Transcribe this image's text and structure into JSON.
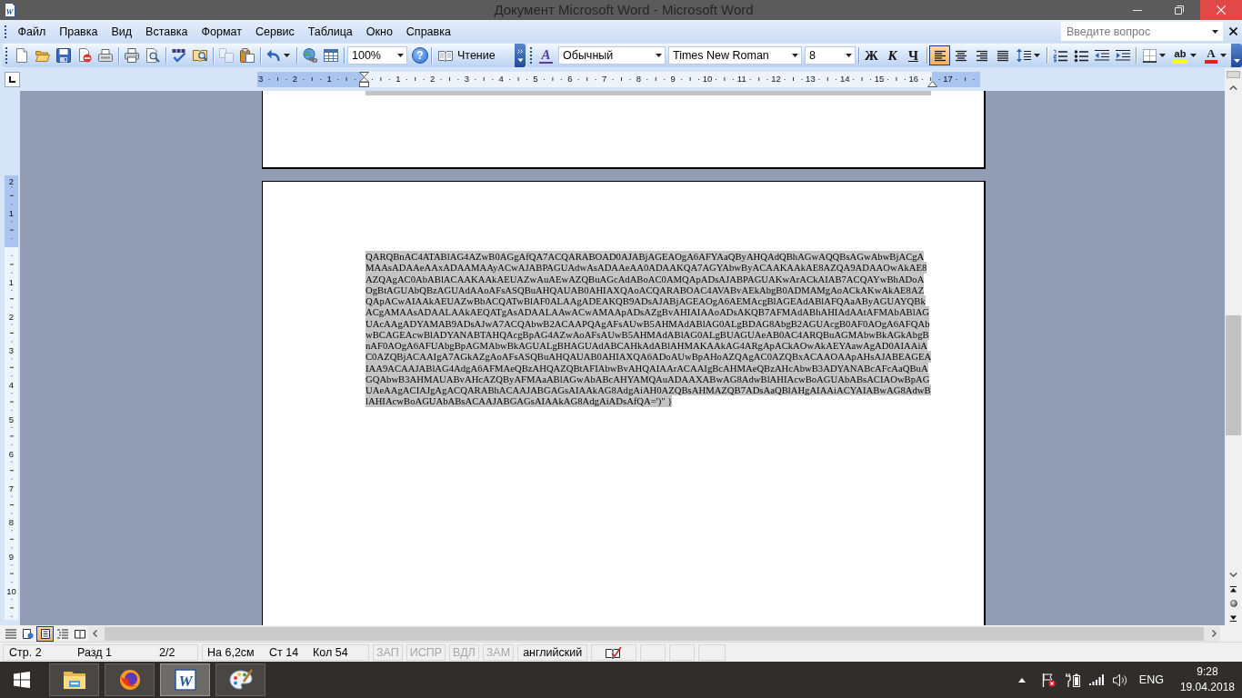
{
  "window": {
    "title": "Документ Microsoft Word - Microsoft Word",
    "icon_letter": "W"
  },
  "menu_bar": {
    "items": [
      "Файл",
      "Правка",
      "Вид",
      "Вставка",
      "Формат",
      "Сервис",
      "Таблица",
      "Окно",
      "Справка"
    ],
    "question_field": {
      "placeholder": "Введите вопрос"
    }
  },
  "standard_toolbar": {
    "button_groups": [
      [
        {
          "kind": "new",
          "disabled": false
        },
        {
          "kind": "open",
          "disabled": false
        },
        {
          "kind": "save",
          "disabled": false
        },
        {
          "kind": "permission",
          "disabled": false
        },
        {
          "kind": "email",
          "disabled": false
        }
      ],
      [
        {
          "kind": "print",
          "disabled": false
        },
        {
          "kind": "preview",
          "disabled": false
        }
      ],
      [
        {
          "kind": "spelling",
          "disabled": false
        },
        {
          "kind": "research",
          "disabled": false
        }
      ],
      [
        {
          "kind": "copy",
          "disabled": true
        },
        {
          "kind": "paste",
          "disabled": false
        }
      ],
      [
        {
          "kind": "undo",
          "disabled": false
        }
      ],
      [
        {
          "kind": "hyperlink",
          "disabled": false
        },
        {
          "kind": "table",
          "disabled": false
        }
      ]
    ],
    "zoom": "100%",
    "help_glyph": "?",
    "reading_button": "Чтение"
  },
  "formatting_toolbar": {
    "styles_glyph": "A",
    "style": "Обычный",
    "font": "Times New Roman",
    "size": "8",
    "emphasis": [
      {
        "kind": "bold",
        "label": "Ж",
        "pressed": false
      },
      {
        "kind": "italic",
        "label": "К",
        "pressed": false
      },
      {
        "kind": "underline",
        "label": "Ч",
        "pressed": false
      }
    ],
    "alignment": [
      {
        "kind": "left",
        "selected": true
      },
      {
        "kind": "center",
        "selected": false
      },
      {
        "kind": "right",
        "selected": false
      },
      {
        "kind": "justify",
        "selected": false
      }
    ],
    "highlight_glyph": "ab",
    "font_color_glyph": "A"
  },
  "ruler": {
    "left_margin_labels": [
      "3",
      "2",
      "1"
    ],
    "labels": [
      "1",
      "2",
      "3",
      "4",
      "5",
      "6",
      "7",
      "8",
      "9",
      "10",
      "11",
      "12",
      "13",
      "14",
      "15",
      "16"
    ],
    "right_margin_labels": [
      "17"
    ]
  },
  "vertical_ruler": {
    "top_margin_labels": [
      "2",
      "1"
    ],
    "labels": [
      "1",
      "2",
      "3",
      "4",
      "5",
      "6",
      "7",
      "8",
      "9",
      "10"
    ]
  },
  "document": {
    "page_1": {
      "selected": true
    },
    "page_2": {
      "selected": true,
      "lines": [
        "QARQBnAC4ATABlAG4AZwB0AGgAfQA7ACQARABOAD0AJABjAGEAOgA6AFYAaQByAHQAdQBhAGwAQQBsAGwAbwBjACgA",
        "MAAsADAAeAAxADAAMAAyACwAJABPAGUAdwAsADAAeAA0ADAAKQA7AGYAbwByACAAKAAkAE8AZQA9ADAAOwAkAE8",
        "AZQAgAC0AbABlACAAKAAkAEUAZwAuAEwAZQBuAGcAdABoAC0AMQApADsAJABPAGUAKwArACkAIAB7ACQAYwBhADoA",
        "OgBtAGUAbQBzAGUAdAAoAFsASQBuAHQAUAB0AHIAXQAoACQARABOAC4AVABvAEkAbgB0ADMAMgAoACkAKwAkAE8AZ",
        "QApACwAIAAkAEUAZwBbACQATwBlAF0ALAAgADEAKQB9ADsAJABjAGEAOgA6AEMAcgBlAGEAdABlAFQAaAByAGUAYQBk",
        "ACgAMAAsADAALAAkAEQATgAsADAALAAwACwAMAApADsAZgBvAHIAIAAoADsAKQB7AFMAdABhAHIAdAAtAFMAbABlAG",
        "UAcAAgADYAMAB9ADsAJwA7ACQAbwB2ACAAPQAgAFsAUwB5AHMAdABlAG0ALgBDAG8AbgB2AGUAcgB0AF0AOgA6AFQAb",
        "wBCAGEAcwBlADYANABTAHQAcgBpAG4AZwAoAFsAUwB5AHMAdABlAG0ALgBUAGUAeAB0AC4ARQBuAGMAbwBkAGkAbgB",
        "nAF0AOgA6AFUAbgBpAGMAbwBkAGUALgBHAGUAdABCAHkAdABlAHMAKAAkAG4ARgApACkAOwAkAEYAawAgAD0AIAAiA",
        "C0AZQBjACAAIgA7AGkAZgAoAFsASQBuAHQAUAB0AHIAXQA6ADoAUwBpAHoAZQAgAC0AZQBxACAAOAApAHsAJABEAGEA",
        "IAA9ACAAJABlAG4AdgA6AFMAeQBzAHQAZQBtAFIAbwBvAHQAIAArACAAIgBcAHMAeQBzAHcAbwB3ADYANABcAFcAaQBuA",
        "GQAbwB3AHMAUABvAHcAZQByAFMAaABlAGwAbABcAHYAMQAuADAAXABwAG8AdwBlAHIAcwBoAGUAbABsACIAOwBpAG",
        "UAeAAgACIAJgAgACQARABhACAAJABGAGsAIAAkAG8AdgAiAH0AZQBsAHMAZQB7ADsAaQBlAHgAIAAiACYAIABwAG8AdwB",
        "lAHIAcwBoAGUAbABsACAAJABGAGsAIAAkAG8AdgAiADsAfQA=')\" }"
      ]
    }
  },
  "view_buttons": [
    {
      "kind": "normal",
      "selected": false
    },
    {
      "kind": "web",
      "selected": false
    },
    {
      "kind": "print",
      "selected": true
    },
    {
      "kind": "outline",
      "selected": false
    },
    {
      "kind": "reading",
      "selected": false
    }
  ],
  "status_bar": {
    "page": "Стр. 2",
    "section": "Разд 1",
    "pages": "2/2",
    "position": "На 6,2см",
    "line": "Ст 14",
    "column": "Кол 54",
    "modes": [
      {
        "label": "ЗАП",
        "on": false
      },
      {
        "label": "ИСПР",
        "on": false
      },
      {
        "label": "ВДЛ",
        "on": false
      },
      {
        "label": "ЗАМ",
        "on": false
      }
    ],
    "language": "английский"
  },
  "taskbar": {
    "apps": [
      {
        "kind": "folder",
        "active": false
      },
      {
        "kind": "fox",
        "active": false
      },
      {
        "kind": "word",
        "active": true,
        "letter": "W"
      },
      {
        "kind": "palette",
        "active": false
      }
    ],
    "input_language": "ENG",
    "time": "9:28",
    "date": "19.04.2018"
  }
}
